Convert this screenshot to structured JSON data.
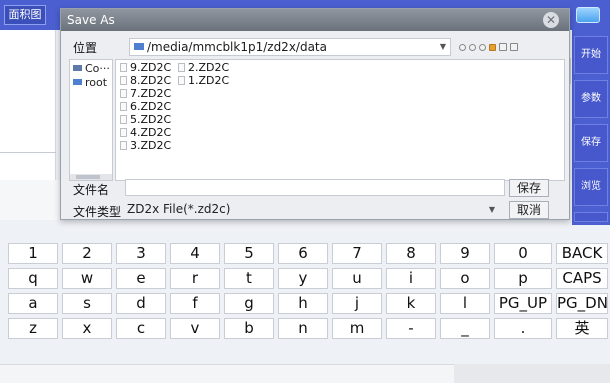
{
  "app": {
    "top_tab_label": "面积图",
    "right_buttons": [
      "开始",
      "参数",
      "保存",
      "浏览"
    ]
  },
  "dialog": {
    "title": "Save As",
    "close_icon": "close-icon",
    "location_label": "位置",
    "location_path": "/media/mmcblk1p1/zd2x/data",
    "sidebar": [
      {
        "label": "Co···",
        "icon": "computer-icon"
      },
      {
        "label": "root",
        "icon": "folder-icon"
      }
    ],
    "files_col1": [
      "9.ZD2C",
      "8.ZD2C",
      "7.ZD2C",
      "6.ZD2C",
      "5.ZD2C",
      "4.ZD2C",
      "3.ZD2C"
    ],
    "files_col2": [
      "2.ZD2C",
      "1.ZD2C"
    ],
    "filename_label": "文件名",
    "filename_value": "",
    "filetype_label": "文件类型",
    "filetype_value": "ZD2x File(*.zd2c)",
    "save_label": "保存",
    "cancel_label": "取消"
  },
  "keyboard": {
    "row1": [
      "1",
      "2",
      "3",
      "4",
      "5",
      "6",
      "7",
      "8",
      "9",
      "0",
      "BACK"
    ],
    "row2": [
      "q",
      "w",
      "e",
      "r",
      "t",
      "y",
      "u",
      "i",
      "o",
      "p",
      "CAPS"
    ],
    "row3": [
      "a",
      "s",
      "d",
      "f",
      "g",
      "h",
      "j",
      "k",
      "l",
      "PG_UP",
      "PG_DN"
    ],
    "row4": [
      "z",
      "x",
      "c",
      "v",
      "b",
      "n",
      "m",
      "-",
      "_",
      ".",
      "英"
    ]
  }
}
